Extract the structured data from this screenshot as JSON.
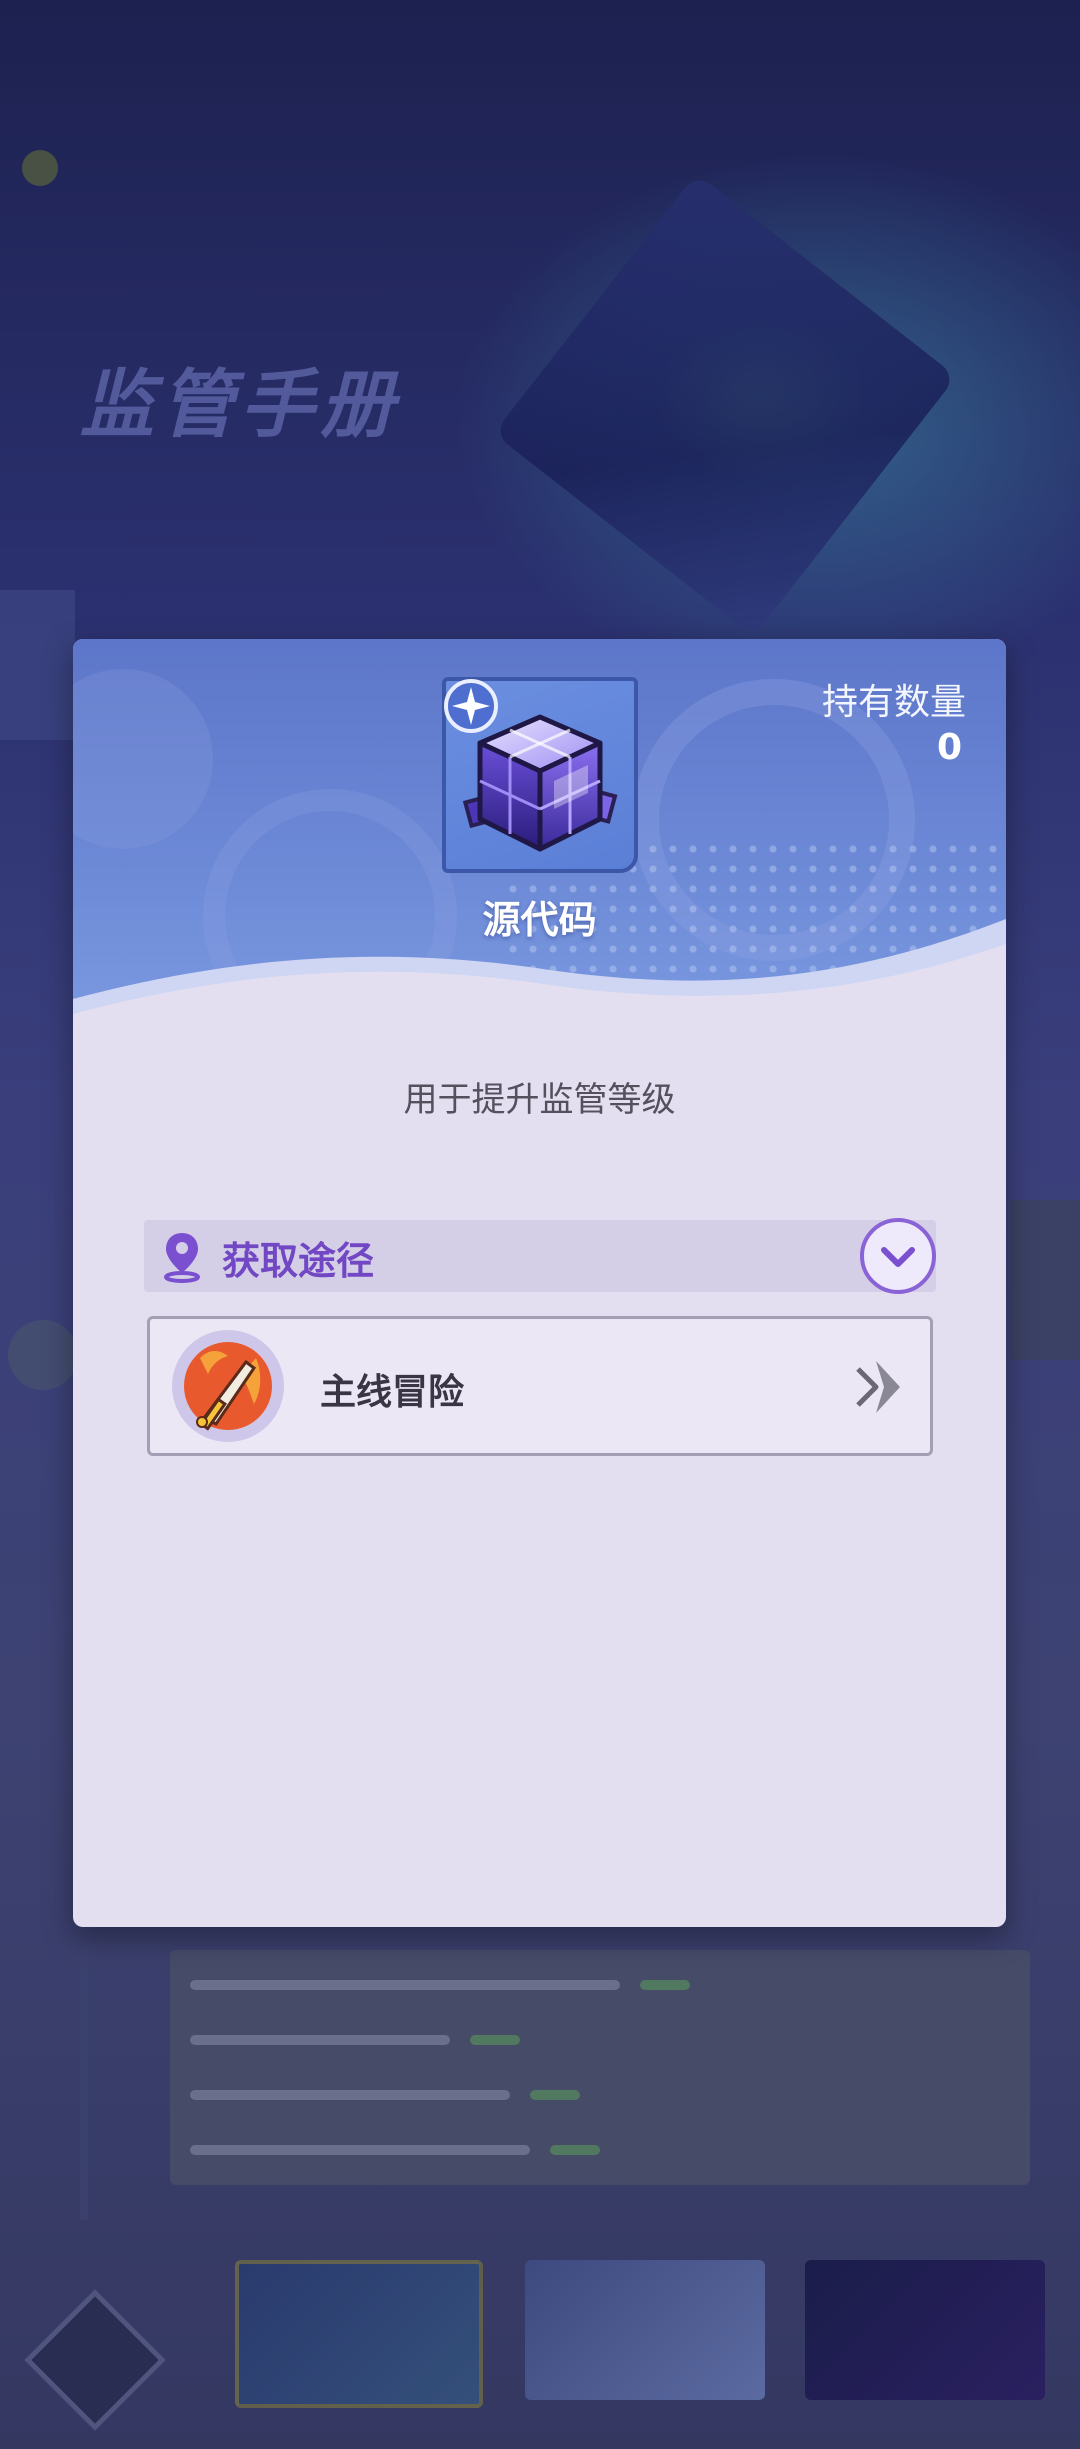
{
  "dialog": {
    "item_name": "源代码",
    "held_label": "持有数量",
    "held_value": "0",
    "description": "用于提升监管等级",
    "section_title": "获取途径",
    "sources": [
      {
        "label": "主线冒险",
        "icon": "sword-emblem-icon"
      }
    ]
  },
  "background": {
    "title_watermark": "监管手册"
  },
  "icons": {
    "item": "source-code-cube-icon",
    "rarity": "star-badge-icon",
    "section": "location-pin-icon",
    "collapse": "chevron-down-icon",
    "go": "arrow-right-icon"
  },
  "colors": {
    "header_blue": "#6d8ad7",
    "dialog_body": "#e3dff0",
    "accent_purple": "#7247c4"
  }
}
